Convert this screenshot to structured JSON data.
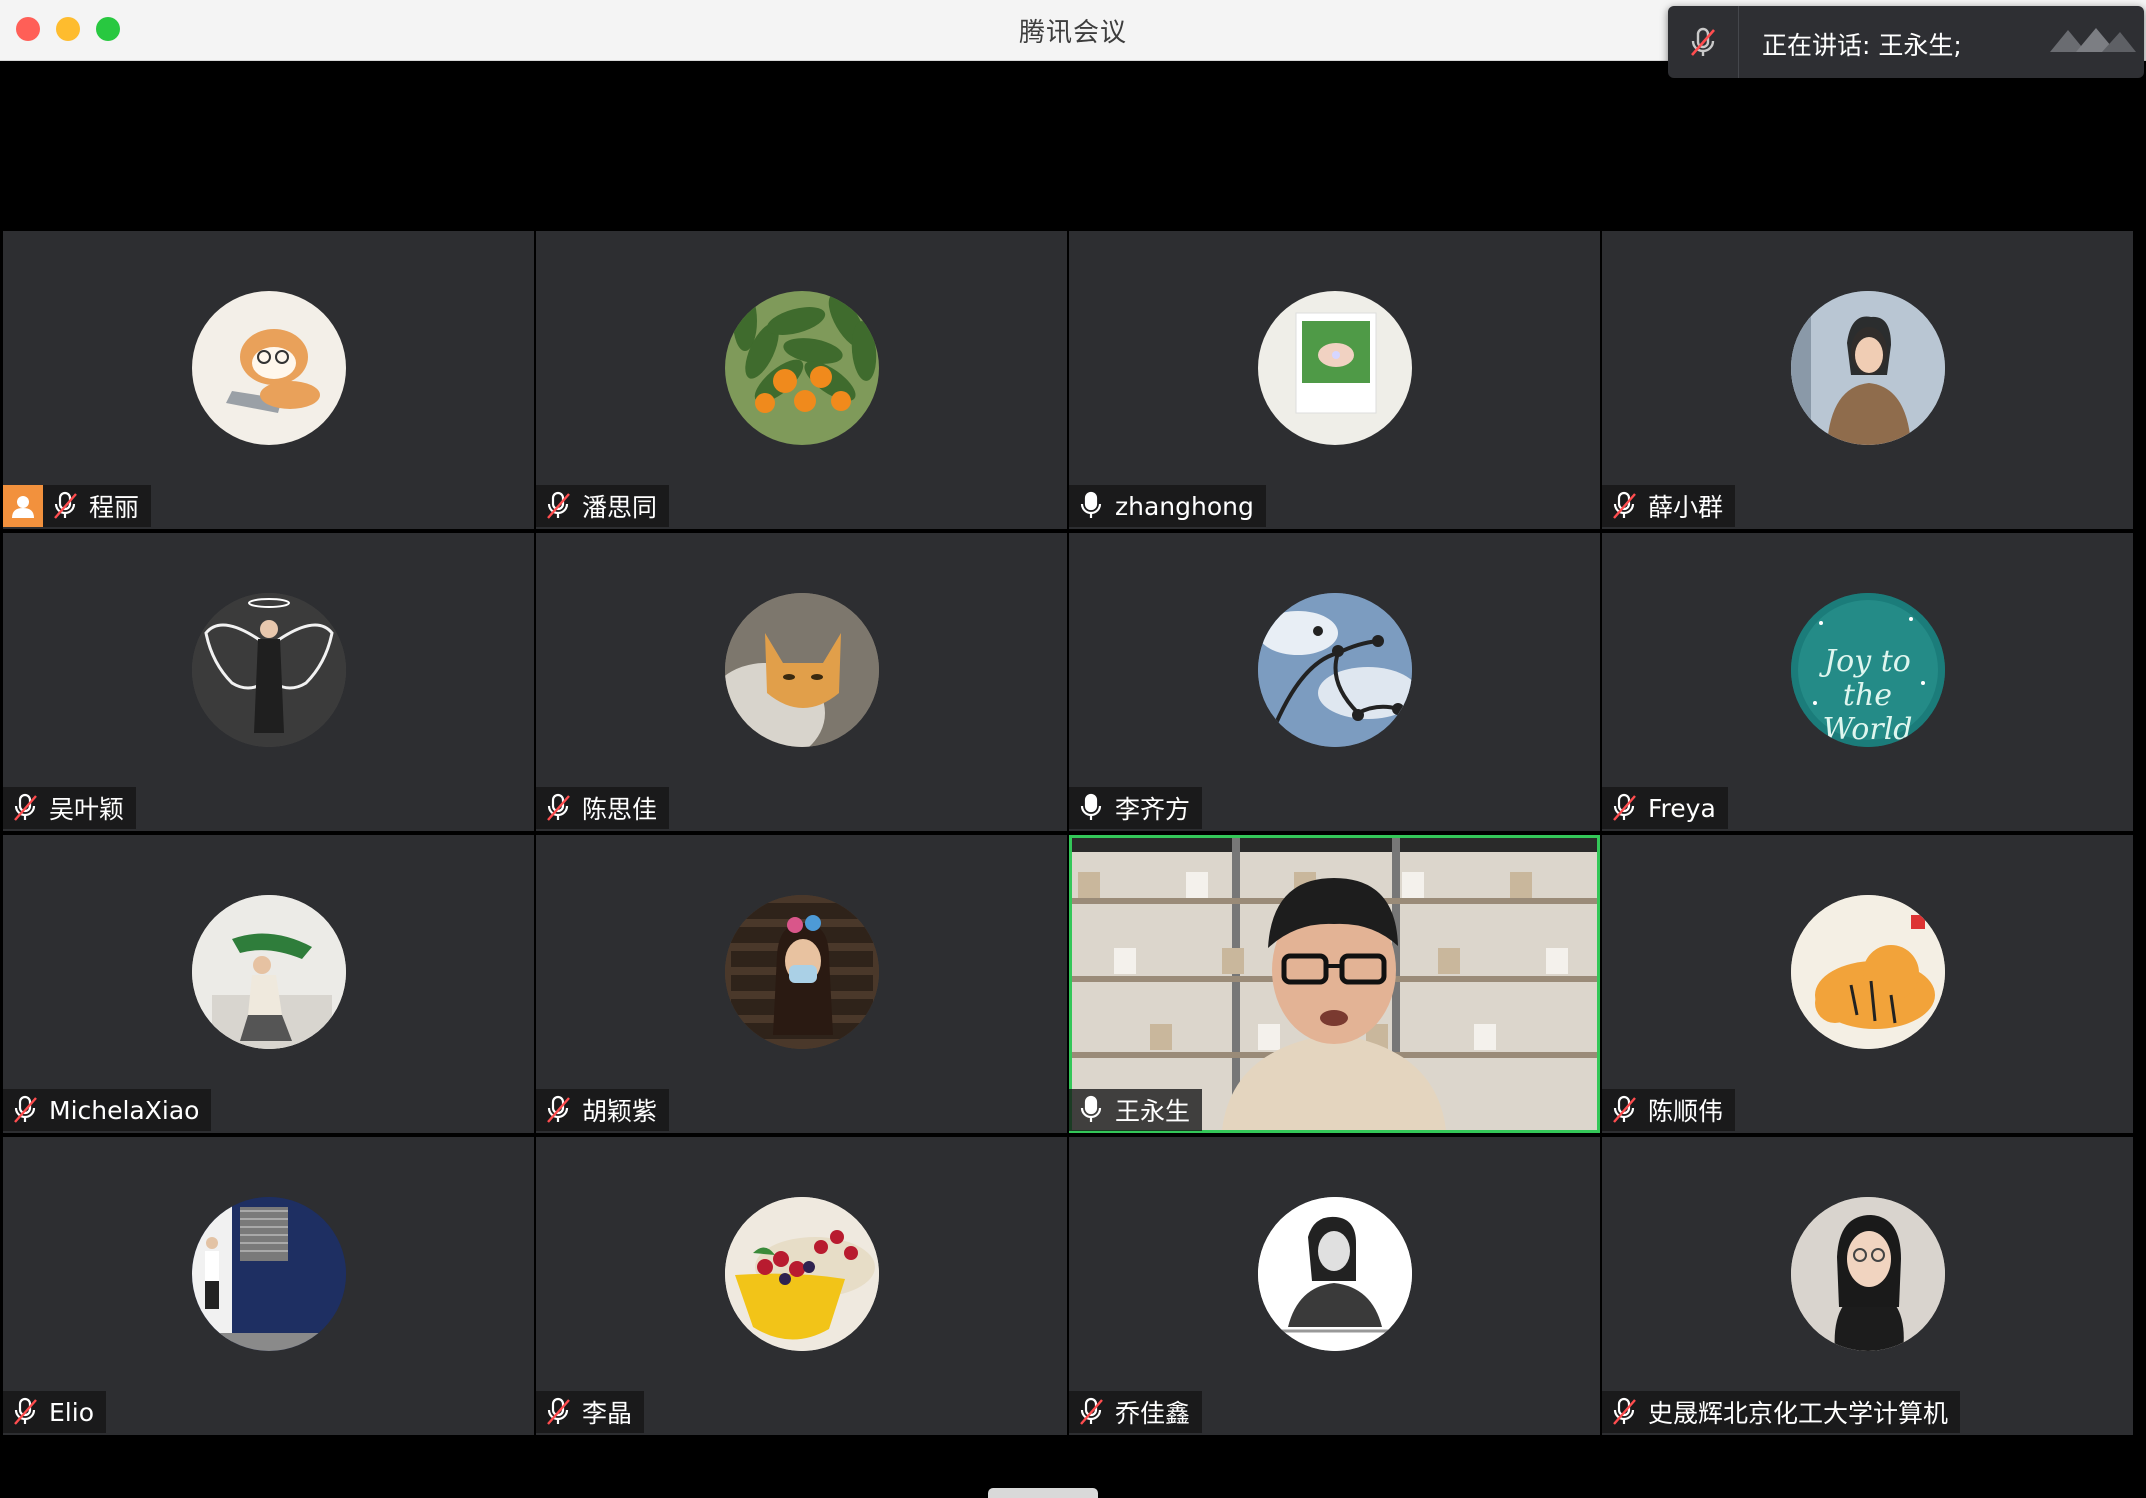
{
  "window": {
    "title": "腾讯会议"
  },
  "speaking": {
    "text": "正在讲话: 王永生;"
  },
  "participants": [
    {
      "name": "程丽",
      "mic": "muted",
      "host": true,
      "avatar": "cat-laptop",
      "bg": "#f3efe8"
    },
    {
      "name": "潘思同",
      "mic": "muted",
      "host": false,
      "avatar": "orange-tree",
      "bg": "#7f9a5a"
    },
    {
      "name": "zhanghong",
      "mic": "on",
      "host": false,
      "avatar": "ring-photo",
      "bg": "#efeee8"
    },
    {
      "name": "薛小群",
      "mic": "muted",
      "host": false,
      "avatar": "woman-coat",
      "bg": "#a9b8c7"
    },
    {
      "name": "吴叶颖",
      "mic": "muted",
      "host": false,
      "avatar": "angel-wings",
      "bg": "#4a4a4a"
    },
    {
      "name": "陈思佳",
      "mic": "muted",
      "host": false,
      "avatar": "orange-cat",
      "bg": "#8a8378"
    },
    {
      "name": "李齐方",
      "mic": "on",
      "host": false,
      "avatar": "sky-branch",
      "bg": "#6e8db2"
    },
    {
      "name": "Freya",
      "mic": "muted",
      "host": false,
      "avatar": "joy-world",
      "bg": "#1f7f7c",
      "avatar_text": "Joy to the World"
    },
    {
      "name": "MichelaXiao",
      "mic": "muted",
      "host": false,
      "avatar": "woman-sofa",
      "bg": "#e8e6e1"
    },
    {
      "name": "胡颖紫",
      "mic": "muted",
      "host": false,
      "avatar": "woman-mask",
      "bg": "#5a4333"
    },
    {
      "name": "王永生",
      "mic": "on",
      "host": false,
      "avatar": "video",
      "bg": "#d6d0c6",
      "active": true
    },
    {
      "name": "陈顺伟",
      "mic": "muted",
      "host": false,
      "avatar": "tiger",
      "bg": "#f3ede1"
    },
    {
      "name": "Elio",
      "mic": "muted",
      "host": false,
      "avatar": "man-blue-wall",
      "bg": "#1d2d5c"
    },
    {
      "name": "李晶",
      "mic": "muted",
      "host": false,
      "avatar": "fruit-bowl",
      "bg": "#f5f2ec"
    },
    {
      "name": "乔佳鑫",
      "mic": "muted",
      "host": false,
      "avatar": "bw-girl",
      "bg": "#ffffff"
    },
    {
      "name": "史晟辉北京化工大学计算机",
      "mic": "muted",
      "host": false,
      "avatar": "woman-portrait",
      "bg": "#d8d3cd"
    }
  ]
}
